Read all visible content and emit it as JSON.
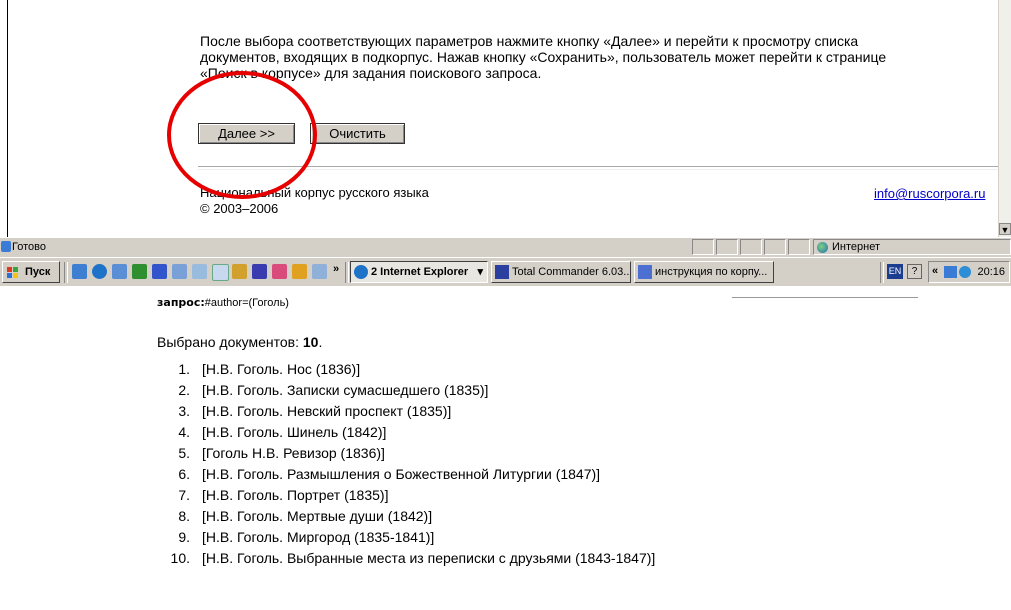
{
  "browser_page": {
    "paragraph": [
      "После выбора соответствующих параметров нажмите кнопку «Далее» и перейти к просмотру списка",
      "документов, входящих в подкорпус. Нажав кнопку «Сохранить», пользователь может перейти к странице",
      "«Поиск в корпусе» для задания поискового запроса."
    ],
    "next_button": "Далее >>",
    "clear_button": "Очистить",
    "footer_name": "Национальный корпус русского языка",
    "footer_copyright": "© 2003–2006",
    "footer_email": "info@ruscorpora.ru",
    "highlight_color": "#e60000"
  },
  "statusbar": {
    "status": "Готово",
    "zone": "Интернет"
  },
  "taskbar": {
    "start": "Пуск",
    "overflow": "»",
    "tasks": [
      {
        "label": "2 Internet Explorer",
        "icon": "ie-icon",
        "arrow": "▾"
      },
      {
        "label": "Total Commander 6.03...",
        "icon": "total-commander-icon"
      },
      {
        "label": "инструкция по корпу...",
        "icon": "word-document-icon"
      }
    ],
    "lang": "EN",
    "help": "?",
    "tray_chevron": "«",
    "time": "20:16"
  },
  "results": {
    "query_label": "запрос:",
    "query_value": "#author=(Гоголь)",
    "count_label": "Выбрано документов: ",
    "count_value": "10",
    "count_suffix": ".",
    "documents": [
      {
        "num": "1.",
        "title": "[Н.В. Гоголь. Нос (1836)]"
      },
      {
        "num": "2.",
        "title": "[Н.В. Гоголь. Записки сумасшедшего (1835)]"
      },
      {
        "num": "3.",
        "title": "[Н.В. Гоголь. Невский проспект (1835)]"
      },
      {
        "num": "4.",
        "title": "[Н.В. Гоголь. Шинель (1842)]"
      },
      {
        "num": "5.",
        "title": "[Гоголь Н.В. Ревизор (1836)]"
      },
      {
        "num": "6.",
        "title": "[Н.В. Гоголь. Размышления о Божественной Литургии (1847)]"
      },
      {
        "num": "7.",
        "title": "[Н.В. Гоголь. Портрет (1835)]"
      },
      {
        "num": "8.",
        "title": "[Н.В. Гоголь. Мертвые души (1842)]"
      },
      {
        "num": "9.",
        "title": "[Н.В. Гоголь. Миргород (1835-1841)]"
      },
      {
        "num": "10.",
        "title": "[Н.В. Гоголь. Выбранные места из переписки с друзьями (1843-1847)]"
      }
    ]
  }
}
